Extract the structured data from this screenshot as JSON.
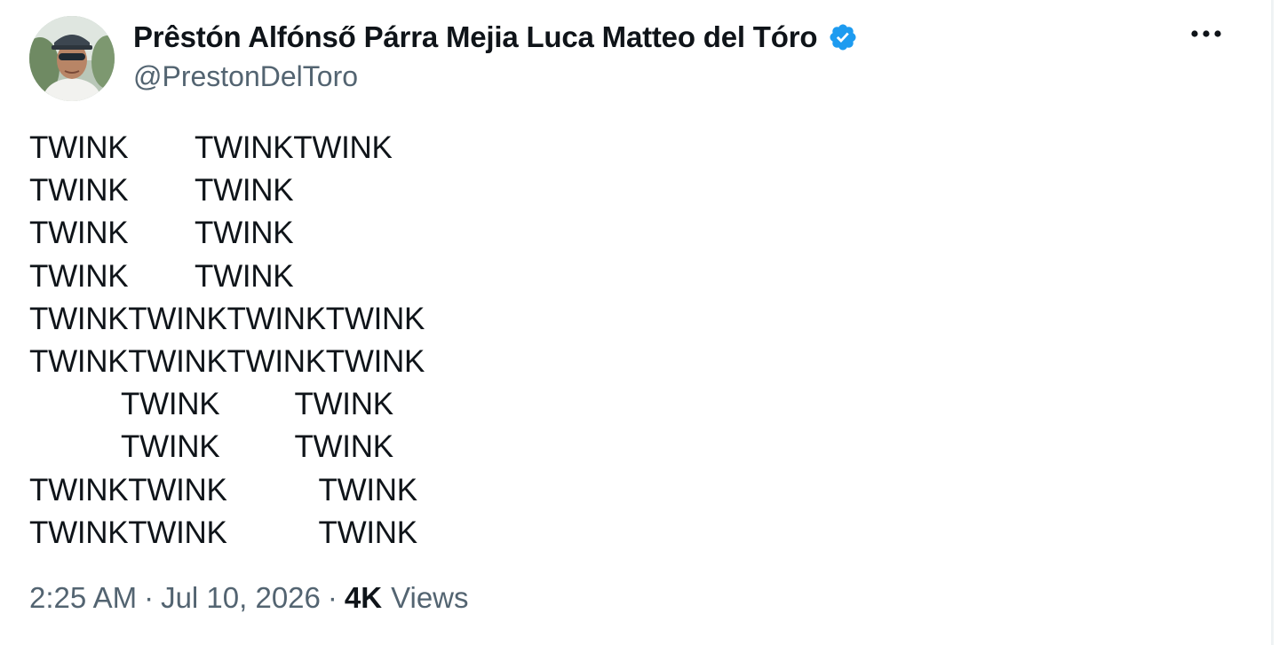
{
  "user": {
    "display_name": "Prêstón Alfónső Párra Mejia Luca Matteo del Tóro",
    "handle": "@PrestonDelToro",
    "verified_icon": "verified-badge-icon",
    "avatar_icon": "profile-avatar"
  },
  "more_icon": "more-icon",
  "tweet": {
    "text": "TWINK        TWINKTWINK\nTWINK        TWINK\nTWINK        TWINK\nTWINK        TWINK\nTWINKTWINKTWINKTWINK\nTWINKTWINKTWINKTWINK\n           TWINK         TWINK\n           TWINK         TWINK\nTWINKTWINK           TWINK\nTWINKTWINK           TWINK"
  },
  "meta": {
    "time": "2:25 AM",
    "separator": "·",
    "date": "Jul 10, 2026",
    "views_count": "4K",
    "views_label": "Views"
  },
  "colors": {
    "text": "#0f1419",
    "secondary": "#536471",
    "verified": "#1d9bf0"
  }
}
